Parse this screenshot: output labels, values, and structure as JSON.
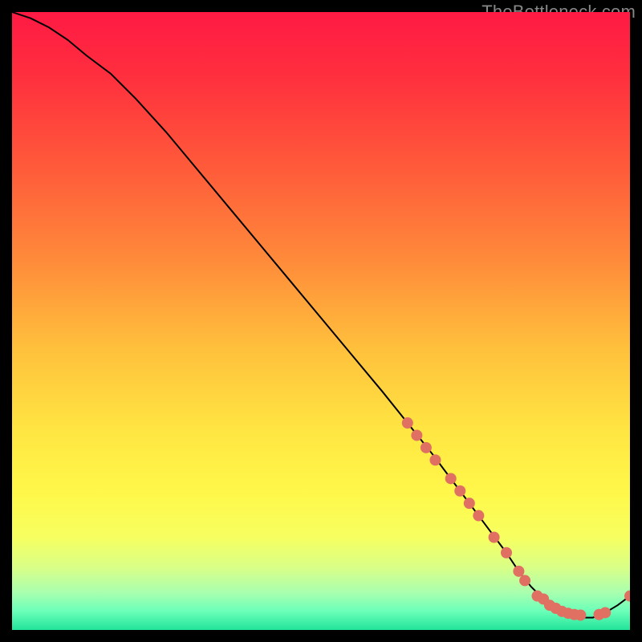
{
  "watermark": "TheBottleneck.com",
  "chart_data": {
    "type": "line",
    "title": "",
    "xlabel": "",
    "ylabel": "",
    "xlim": [
      0,
      100
    ],
    "ylim": [
      0,
      100
    ],
    "grid": false,
    "background": "rainbow-gradient",
    "gradient_stops": [
      {
        "offset": 0.0,
        "color": "#ff1a44"
      },
      {
        "offset": 0.1,
        "color": "#ff2e3e"
      },
      {
        "offset": 0.25,
        "color": "#ff5a3a"
      },
      {
        "offset": 0.4,
        "color": "#ff8a3a"
      },
      {
        "offset": 0.55,
        "color": "#ffc23c"
      },
      {
        "offset": 0.68,
        "color": "#ffe642"
      },
      {
        "offset": 0.78,
        "color": "#fff84a"
      },
      {
        "offset": 0.85,
        "color": "#f7ff60"
      },
      {
        "offset": 0.9,
        "color": "#d8ff88"
      },
      {
        "offset": 0.94,
        "color": "#a8ffb0"
      },
      {
        "offset": 0.97,
        "color": "#6affb8"
      },
      {
        "offset": 1.0,
        "color": "#22e39a"
      }
    ],
    "series": [
      {
        "name": "bottleneck-curve",
        "color": "#000000",
        "x": [
          0,
          3,
          6,
          9,
          12,
          16,
          20,
          25,
          30,
          35,
          40,
          45,
          50,
          55,
          60,
          64,
          68,
          71,
          74,
          77,
          80,
          82,
          84,
          86,
          88,
          90,
          92,
          94,
          96,
          98,
          100
        ],
        "y": [
          100,
          99,
          97.5,
          95.5,
          93,
          90,
          86,
          80.5,
          74.5,
          68.5,
          62.5,
          56.5,
          50.5,
          44.5,
          38.5,
          33.5,
          28.5,
          24.5,
          20.5,
          16.5,
          12.5,
          9.5,
          7.0,
          5.0,
          3.5,
          2.5,
          2.0,
          2.0,
          2.8,
          4.0,
          5.5
        ]
      }
    ],
    "markers": {
      "name": "highlight-dots",
      "color": "#e07062",
      "radius": 7,
      "points": [
        {
          "x": 64,
          "y": 33.5
        },
        {
          "x": 65.5,
          "y": 31.5
        },
        {
          "x": 67,
          "y": 29.5
        },
        {
          "x": 68.5,
          "y": 27.5
        },
        {
          "x": 71,
          "y": 24.5
        },
        {
          "x": 72.5,
          "y": 22.5
        },
        {
          "x": 74,
          "y": 20.5
        },
        {
          "x": 75.5,
          "y": 18.5
        },
        {
          "x": 78,
          "y": 15.0
        },
        {
          "x": 80,
          "y": 12.5
        },
        {
          "x": 82,
          "y": 9.5
        },
        {
          "x": 83,
          "y": 8.0
        },
        {
          "x": 85,
          "y": 5.5
        },
        {
          "x": 86,
          "y": 5.0
        },
        {
          "x": 87,
          "y": 4.0
        },
        {
          "x": 88,
          "y": 3.5
        },
        {
          "x": 89,
          "y": 3.0
        },
        {
          "x": 90,
          "y": 2.7
        },
        {
          "x": 91,
          "y": 2.5
        },
        {
          "x": 92,
          "y": 2.4
        },
        {
          "x": 95,
          "y": 2.5
        },
        {
          "x": 96,
          "y": 2.8
        },
        {
          "x": 100,
          "y": 5.5
        }
      ]
    }
  }
}
